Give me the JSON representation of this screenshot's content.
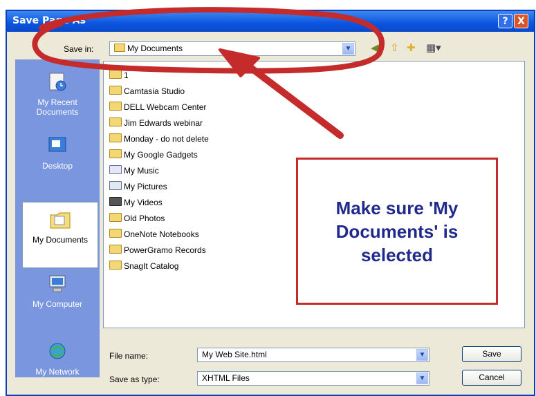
{
  "dialog": {
    "title": "Save Page As",
    "help_btn": "?",
    "close_btn": "X"
  },
  "save_in": {
    "label": "Save in:",
    "value": "My Documents"
  },
  "places": [
    {
      "label_line1": "My Recent",
      "label_line2": "Documents",
      "icon": "recent-documents-icon"
    },
    {
      "label_line1": "Desktop",
      "label_line2": "",
      "icon": "desktop-icon"
    },
    {
      "label_line1": "My Documents",
      "label_line2": "",
      "icon": "my-documents-icon",
      "selected": true
    },
    {
      "label_line1": "My Computer",
      "label_line2": "",
      "icon": "my-computer-icon"
    },
    {
      "label_line1": "My Network",
      "label_line2": "",
      "icon": "my-network-icon"
    }
  ],
  "files": [
    {
      "name": "1",
      "icon": "folder"
    },
    {
      "name": "Camtasia Studio",
      "icon": "folder"
    },
    {
      "name": "DELL Webcam Center",
      "icon": "folder"
    },
    {
      "name": "Jim Edwards webinar",
      "icon": "folder"
    },
    {
      "name": "Monday - do not delete",
      "icon": "folder"
    },
    {
      "name": "My Google Gadgets",
      "icon": "folder"
    },
    {
      "name": "My Music",
      "icon": "music-folder"
    },
    {
      "name": "My Pictures",
      "icon": "pictures-folder"
    },
    {
      "name": "My Videos",
      "icon": "videos-folder"
    },
    {
      "name": "Old Photos",
      "icon": "folder"
    },
    {
      "name": "OneNote Notebooks",
      "icon": "folder"
    },
    {
      "name": "PowerGramo Records",
      "icon": "folder"
    },
    {
      "name": "SnagIt Catalog",
      "icon": "folder"
    }
  ],
  "file_name": {
    "label": "File name:",
    "value": "My Web Site.html"
  },
  "save_as_type": {
    "label": "Save as type:",
    "value": "XHTML Files"
  },
  "buttons": {
    "save": "Save",
    "cancel": "Cancel"
  },
  "callout": {
    "text": "Make sure 'My Documents' is selected"
  },
  "colors": {
    "annotation_red": "#c52b2b",
    "callout_text": "#202a8c",
    "titlebar_blue": "#0a55e0"
  }
}
